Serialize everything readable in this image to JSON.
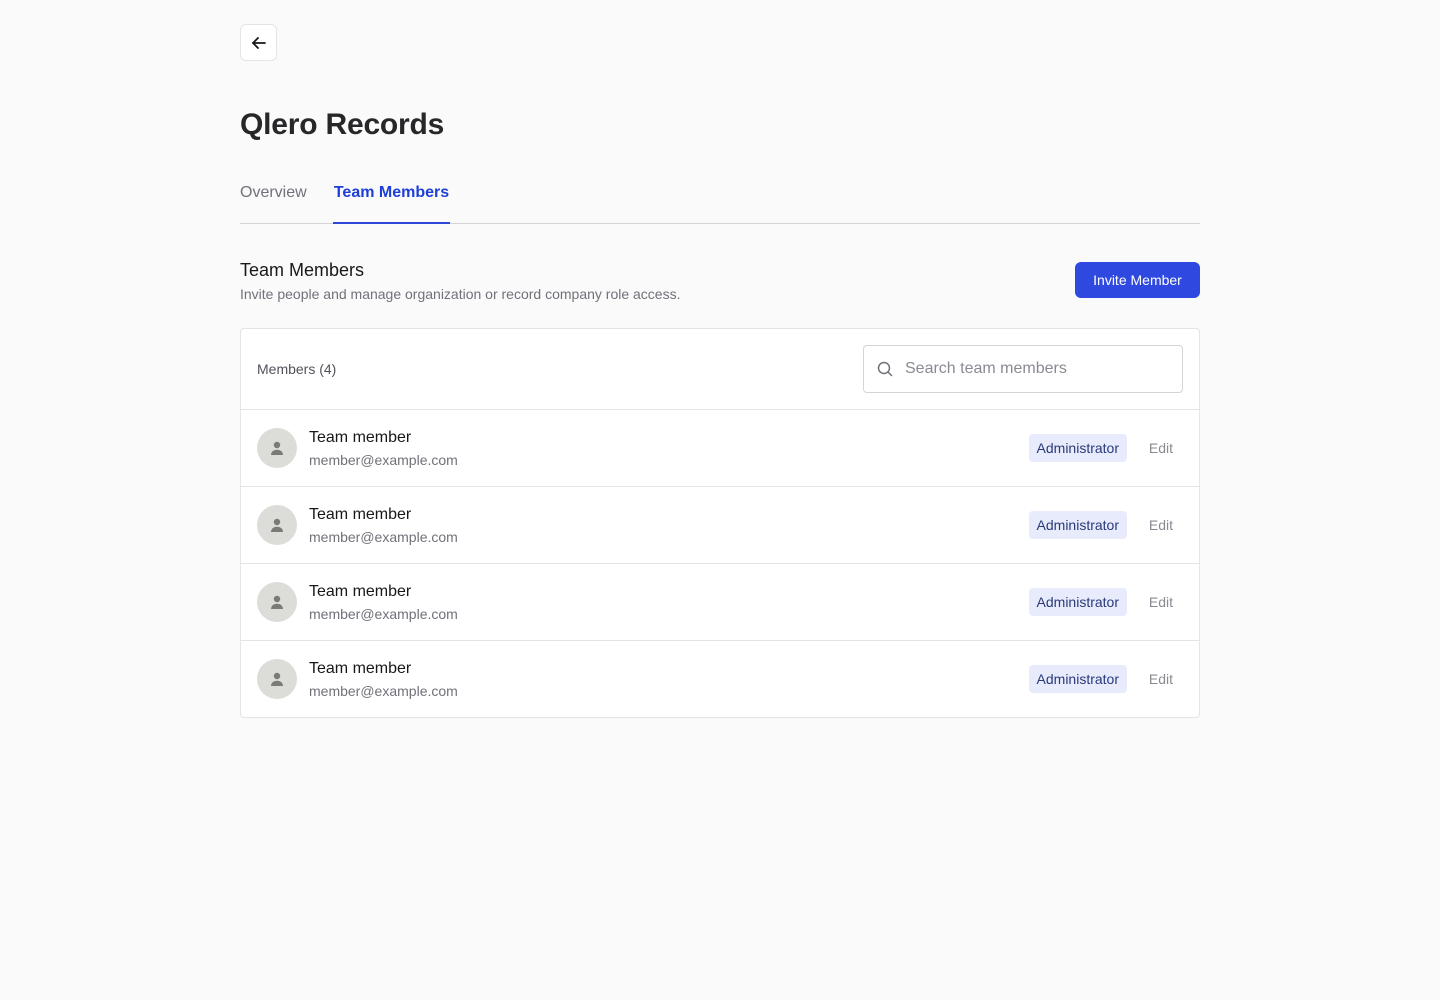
{
  "page": {
    "title": "Qlero Records"
  },
  "tabs": [
    {
      "label": "Overview",
      "active": false
    },
    {
      "label": "Team Members",
      "active": true
    }
  ],
  "section": {
    "title": "Team Members",
    "subtitle": "Invite people and manage organization or record company role access.",
    "invite_label": "Invite Member"
  },
  "members_header": {
    "count_label": "Members (4)",
    "search_placeholder": "Search team members",
    "search_value": ""
  },
  "members": [
    {
      "name": "Team member",
      "email": "member@example.com",
      "role": "Administrator",
      "action": "Edit"
    },
    {
      "name": "Team member",
      "email": "member@example.com",
      "role": "Administrator",
      "action": "Edit"
    },
    {
      "name": "Team member",
      "email": "member@example.com",
      "role": "Administrator",
      "action": "Edit"
    },
    {
      "name": "Team member",
      "email": "member@example.com",
      "role": "Administrator",
      "action": "Edit"
    }
  ],
  "icons": {
    "back": "arrow-left-icon",
    "search": "search-icon",
    "avatar": "user-icon"
  },
  "colors": {
    "accent": "#2f49e0",
    "active_tab": "#1d3fd6",
    "role_badge_bg": "#e7ebfb",
    "background": "#fafafa"
  }
}
